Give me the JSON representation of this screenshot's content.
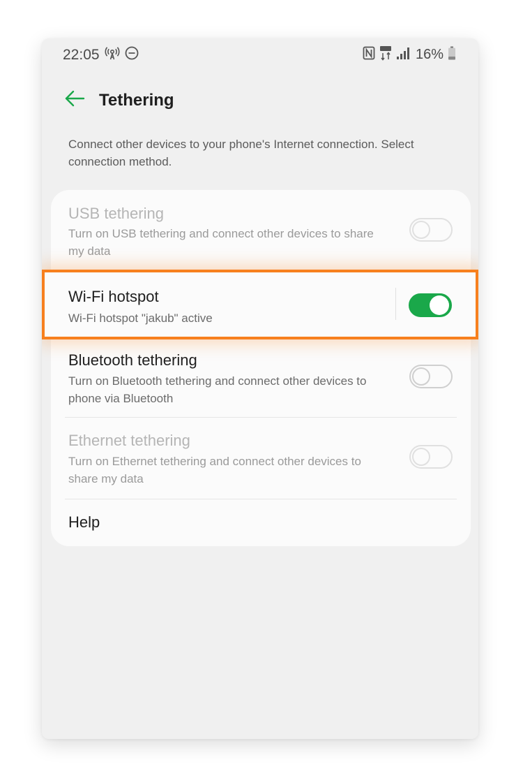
{
  "status_bar": {
    "time": "22:05",
    "battery_percent": "16%",
    "left_icons": [
      "hotspot-icon",
      "do-not-disturb-icon"
    ],
    "right_icons": [
      "nfc-icon",
      "lte-icon",
      "signal-icon",
      "battery-icon"
    ]
  },
  "header": {
    "title": "Tethering"
  },
  "description": "Connect other devices to your phone's Internet connection. Select connection method.",
  "options": [
    {
      "title": "USB tethering",
      "subtitle": "Turn on USB tethering and connect other devices to share my data",
      "enabled": false,
      "on": false
    },
    {
      "title": "Wi-Fi hotspot",
      "subtitle": "Wi-Fi hotspot \"jakub\" active",
      "enabled": true,
      "on": true
    },
    {
      "title": "Bluetooth tethering",
      "subtitle": "Turn on Bluetooth tethering and connect other devices to phone via Bluetooth",
      "enabled": true,
      "on": false
    },
    {
      "title": "Ethernet tethering",
      "subtitle": "Turn on Ethernet tethering and connect other devices to share my data",
      "enabled": false,
      "on": false
    }
  ],
  "help_label": "Help",
  "colors": {
    "accent_green": "#1aa84a",
    "highlight_orange": "#f7801e"
  }
}
